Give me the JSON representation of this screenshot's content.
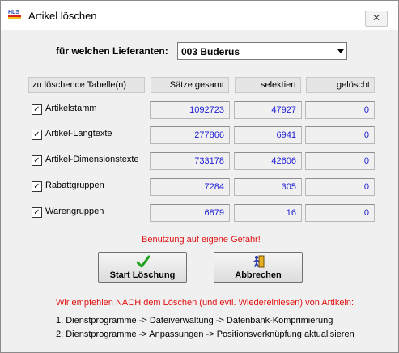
{
  "window": {
    "title": "Artikel löschen",
    "app_icon_text": "HLS",
    "close_symbol": "✕"
  },
  "supplier": {
    "label": "für welchen Lieferanten:",
    "selected": "003 Buderus"
  },
  "table": {
    "headers": [
      "zu löschende Tabelle(n)",
      "Sätze gesamt",
      "selektiert",
      "gelöscht"
    ],
    "rows": [
      {
        "label": "Artikelstamm",
        "checked": true,
        "gesamt": "1092723",
        "selektiert": "47927",
        "geloescht": "0"
      },
      {
        "label": "Artikel-Langtexte",
        "checked": true,
        "gesamt": "277866",
        "selektiert": "6941",
        "geloescht": "0"
      },
      {
        "label": "Artikel-Dimensionstexte",
        "checked": true,
        "gesamt": "733178",
        "selektiert": "42606",
        "geloescht": "0"
      },
      {
        "label": "Rabattgruppen",
        "checked": true,
        "gesamt": "7284",
        "selektiert": "305",
        "geloescht": "0"
      },
      {
        "label": "Warengruppen",
        "checked": true,
        "gesamt": "6879",
        "selektiert": "16",
        "geloescht": "0"
      }
    ]
  },
  "warning": "Benutzung auf eigene Gefahr!",
  "buttons": {
    "start": "Start Löschung",
    "cancel": "Abbrechen"
  },
  "recommendation": {
    "heading": "Wir empfehlen NACH dem Löschen (und evtl. Wiedereinlesen) von Artikeln:",
    "steps": [
      "1. Dienstprogramme -> Dateiverwaltung -> Datenbank-Komprimierung",
      "2. Dienstprogramme -> Anpassungen -> Positionsverknüpfung aktualisieren"
    ]
  },
  "colors": {
    "value_text": "#1c1cd8",
    "warning_text": "#e01010",
    "check_icon": "#1aa31a"
  }
}
